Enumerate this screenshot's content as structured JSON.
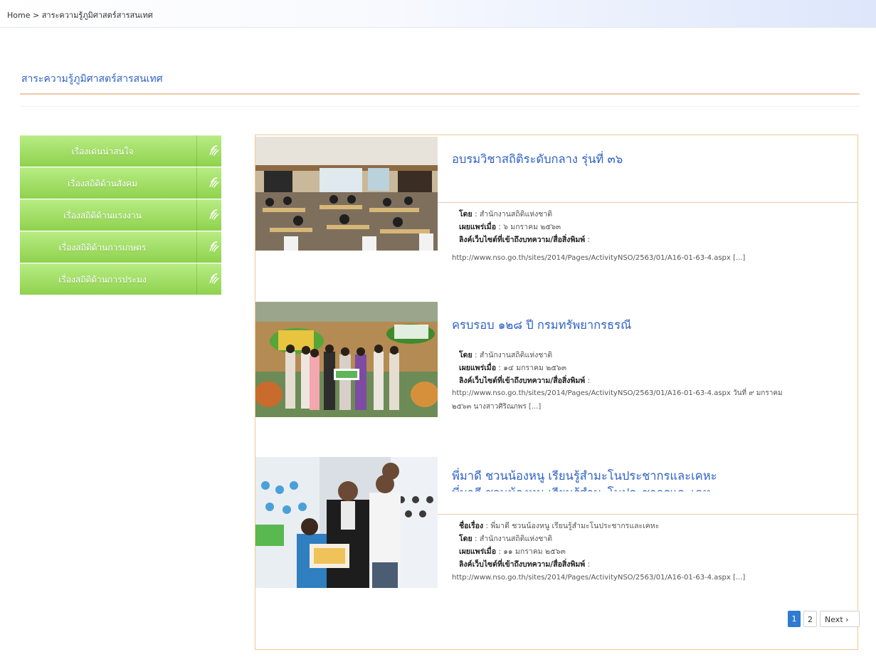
{
  "breadcrumb": "Home > สาระความรู้ภูมิศาสตร์สารสนเทศ",
  "page_title": "สาระความรู้ภูมิศาสตร์สารสนเทศ",
  "sidebar": {
    "items": [
      {
        "label": "เรื่องเด่นน่าสนใจ",
        "icon": "sign-language-icon"
      },
      {
        "label": "เรื่องสถิติด้านสังคม",
        "icon": "sign-language-icon"
      },
      {
        "label": "เรื่องสถิติด้านแรงงาน",
        "icon": "sign-language-icon"
      },
      {
        "label": "เรื่องสถิติด้านการเกษตร",
        "icon": "sign-language-icon"
      },
      {
        "label": "เรื่องสถิติด้านการประมง",
        "icon": "sign-language-icon"
      }
    ]
  },
  "labels": {
    "name": "ชื่อเรื่อง",
    "by": "โดย",
    "published": "เผยแพร่เมื่อ",
    "link": "ลิงค์เว็บไซต์ที่เข้าถึงบทความ/สื่อสิ่งพิมพ์"
  },
  "articles": [
    {
      "title": "อบรมวิชาสถิติระดับกลาง รุ่นที่ ๓๖",
      "by": "สำนักงานสถิติแห่งชาติ",
      "published": "๖ มกราคม ๒๕๖๓",
      "link_lines": [
        "http://www.nso.go.th/sites/2014/Pages/ActivityNSO/2563/01/A16-01-63-4.aspx [...]"
      ]
    },
    {
      "title": "ครบรอบ ๑๒๘ ปี กรมทรัพยากรธรณี",
      "by": "สำนักงานสถิติแห่งชาติ",
      "published": "๑๔ มกราคม ๒๕๖๓",
      "link_lines": [
        "http://www.nso.go.th/sites/2014/Pages/ActivityNSO/2563/01/A16-01-63-4.aspx วันที่ ๙ มกราคม",
        "๒๕๖๓ นางสาวศิริณภพร [...]"
      ]
    },
    {
      "title": "พี่มาดี ชวนน้องหนู เรียนรู้สำมะโนประชากรและเคหะ",
      "name": "พี่มาดี ชวนน้องหนู เรียนรู้สำมะโนประชากรและเคหะ",
      "by": "สำนักงานสถิติแห่งชาติ",
      "published": "๑๑ มกราคม ๒๕๖๓",
      "link_lines": [
        "http://www.nso.go.th/sites/2014/Pages/ActivityNSO/2563/01/A16-01-63-4.aspx [...]"
      ]
    }
  ],
  "pager": {
    "page1": "1",
    "page2": "2",
    "next": "Next ›"
  },
  "colors": {
    "accent": "#2f62c7",
    "sidebar_green": "#8fd24e",
    "border_orange": "#f3c792",
    "active_page": "#2f7bd1"
  }
}
